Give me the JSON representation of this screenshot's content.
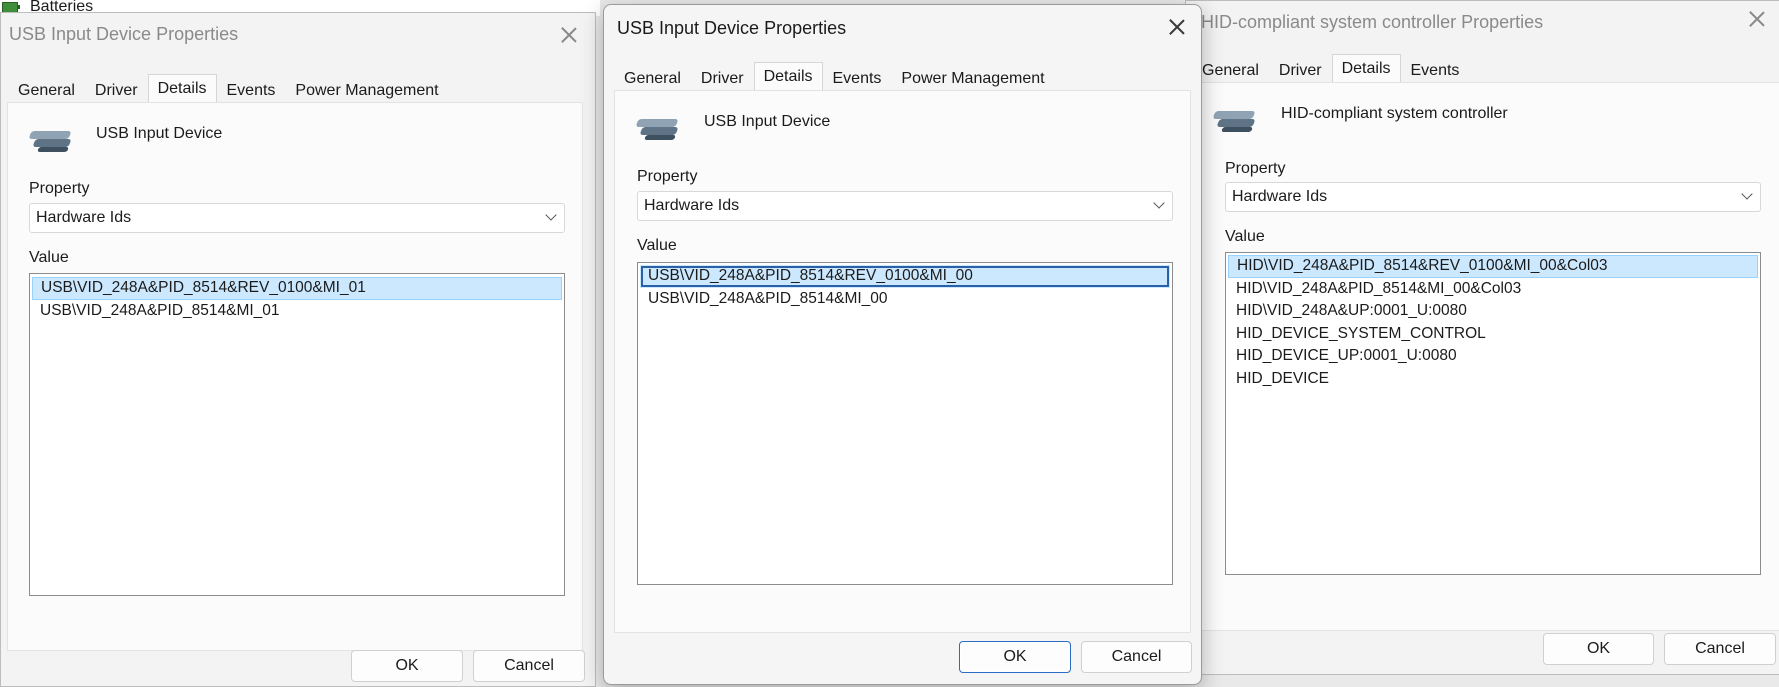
{
  "background": {
    "item_label": "Batteries"
  },
  "dialogs": [
    {
      "title": "USB Input Device Properties",
      "tabs": [
        "General",
        "Driver",
        "Details",
        "Events",
        "Power Management"
      ],
      "selected_tab": "Details",
      "device_name": "USB Input Device",
      "property_label": "Property",
      "property_value": "Hardware Ids",
      "value_label": "Value",
      "values": [
        "USB\\VID_248A&PID_8514&REV_0100&MI_01",
        "USB\\VID_248A&PID_8514&MI_01"
      ],
      "ok_label": "OK",
      "cancel_label": "Cancel"
    },
    {
      "title": "USB Input Device Properties",
      "tabs": [
        "General",
        "Driver",
        "Details",
        "Events",
        "Power Management"
      ],
      "selected_tab": "Details",
      "device_name": "USB Input Device",
      "property_label": "Property",
      "property_value": "Hardware Ids",
      "value_label": "Value",
      "values": [
        "USB\\VID_248A&PID_8514&REV_0100&MI_00",
        "USB\\VID_248A&PID_8514&MI_00"
      ],
      "ok_label": "OK",
      "cancel_label": "Cancel"
    },
    {
      "title": "HID-compliant system controller Properties",
      "tabs": [
        "General",
        "Driver",
        "Details",
        "Events"
      ],
      "selected_tab": "Details",
      "device_name": "HID-compliant system controller",
      "property_label": "Property",
      "property_value": "Hardware Ids",
      "value_label": "Value",
      "values": [
        "HID\\VID_248A&PID_8514&REV_0100&MI_00&Col03",
        "HID\\VID_248A&PID_8514&MI_00&Col03",
        "HID\\VID_248A&UP:0001_U:0080",
        "HID_DEVICE_SYSTEM_CONTROL",
        "HID_DEVICE_UP:0001_U:0080",
        "HID_DEVICE"
      ],
      "ok_label": "OK",
      "cancel_label": "Cancel"
    }
  ],
  "colors": {
    "selection": "#cce8ff",
    "selection_border": "#99d1ff",
    "focus_outline": "#2b5fa6",
    "default_button_border": "#2b6cc4"
  }
}
